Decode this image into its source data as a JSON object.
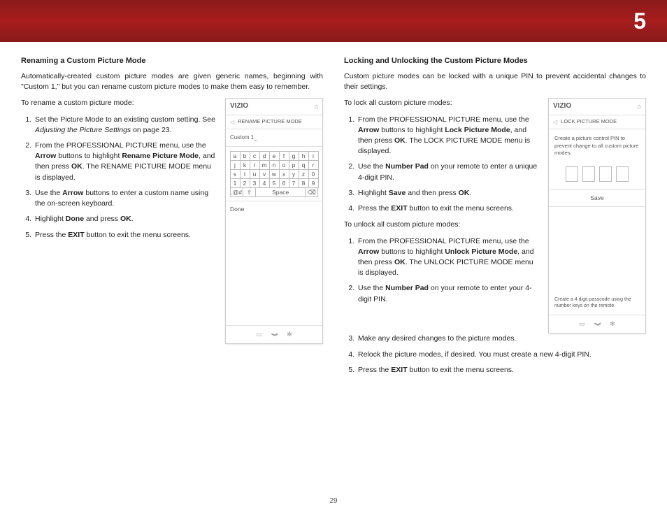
{
  "header": {
    "section_number": "5"
  },
  "page_number": "29",
  "left": {
    "heading": "Renaming a Custom Picture Mode",
    "intro": "Automatically-created custom picture modes are given generic names, beginning with \"Custom 1,\" but you can rename custom picture modes to make them easy to remember.",
    "lead": "To rename a custom picture mode:",
    "step1a": "Set the Picture Mode to an existing custom setting. See ",
    "step1i": "Adjusting the Picture Settings",
    "step1b": " on page 23.",
    "step2a": "From the PROFESSIONAL PICTURE menu, use the ",
    "step2b": " buttons to highlight ",
    "step2c": ", and then press ",
    "step2d": ". The RENAME PICTURE MODE menu is displayed.",
    "step3a": "Use the ",
    "step3b": " buttons to enter a custom name using the on-screen keyboard.",
    "step4a": "Highlight ",
    "step4b": " and press ",
    "step4c": ".",
    "step5a": "Press the ",
    "step5b": " button to exit the menu screens.",
    "terms": {
      "arrow": "Arrow",
      "rename": "Rename Picture Mode",
      "ok": "OK",
      "done": "Done",
      "exit": "EXIT"
    },
    "panel": {
      "brand": "VIZIO",
      "title": "RENAME PICTURE MODE",
      "field": "Custom 1_",
      "done": "Done",
      "kb_rows": [
        [
          "a",
          "b",
          "c",
          "d",
          "e",
          "f",
          "g",
          "h",
          "i"
        ],
        [
          "j",
          "k",
          "l",
          "m",
          "n",
          "o",
          "p",
          "q",
          "r"
        ],
        [
          "s",
          "t",
          "u",
          "v",
          "w",
          "x",
          "y",
          "z",
          "0"
        ],
        [
          "1",
          "2",
          "3",
          "4",
          "5",
          "6",
          "7",
          "8",
          "9"
        ]
      ],
      "sym": ".@#",
      "shift": "⇧",
      "space": "Space",
      "bksp": "⌫"
    }
  },
  "right": {
    "heading": "Locking and Unlocking the Custom Picture Modes",
    "intro": "Custom picture modes can be locked with a unique PIN to prevent accidental changes to their settings.",
    "lead_lock": "To lock all custom picture modes:",
    "l1a": "From the PROFESSIONAL PICTURE menu, use the ",
    "l1b": " buttons to highlight ",
    "l1c": ", and then press ",
    "l1d": ". The LOCK PICTURE MODE menu is displayed.",
    "l2a": "Use the ",
    "l2b": " on your remote to enter a unique 4-digit PIN.",
    "l3a": "Highlight ",
    "l3b": " and then press ",
    "l3c": ".",
    "l4a": "Press the ",
    "l4b": " button to exit the menu screens.",
    "lead_unlock": "To unlock all custom picture modes:",
    "u1a": "From the PROFESSIONAL PICTURE menu, use the ",
    "u1b": " buttons to highlight ",
    "u1c": ", and then press ",
    "u1d": ". The UNLOCK PICTURE MODE menu is displayed.",
    "u2a": "Use the ",
    "u2b": " on your remote to enter your 4-digit PIN.",
    "u3": "Make any desired changes to the picture modes.",
    "u4": "Relock the picture modes, if desired. You must create a new 4-digit PIN.",
    "u5a": "Press the ",
    "u5b": " button to exit the menu screens.",
    "terms": {
      "arrow": "Arrow",
      "lock": "Lock Picture Mode",
      "unlock": "Unlock Picture Mode",
      "ok": "OK",
      "numpad": "Number Pad",
      "save": "Save",
      "exit": "EXIT"
    },
    "panel": {
      "brand": "VIZIO",
      "title": "LOCK PICTURE MODE",
      "desc": "Create a picture control PIN to prevent change to all custom picture modes.",
      "save": "Save",
      "hint": "Create a 4 digit passcode using the number keys on the remote."
    }
  },
  "icons": {
    "home": "⌂",
    "wide": "▭",
    "down": "❱",
    "gear": "✻",
    "back": "◁"
  }
}
